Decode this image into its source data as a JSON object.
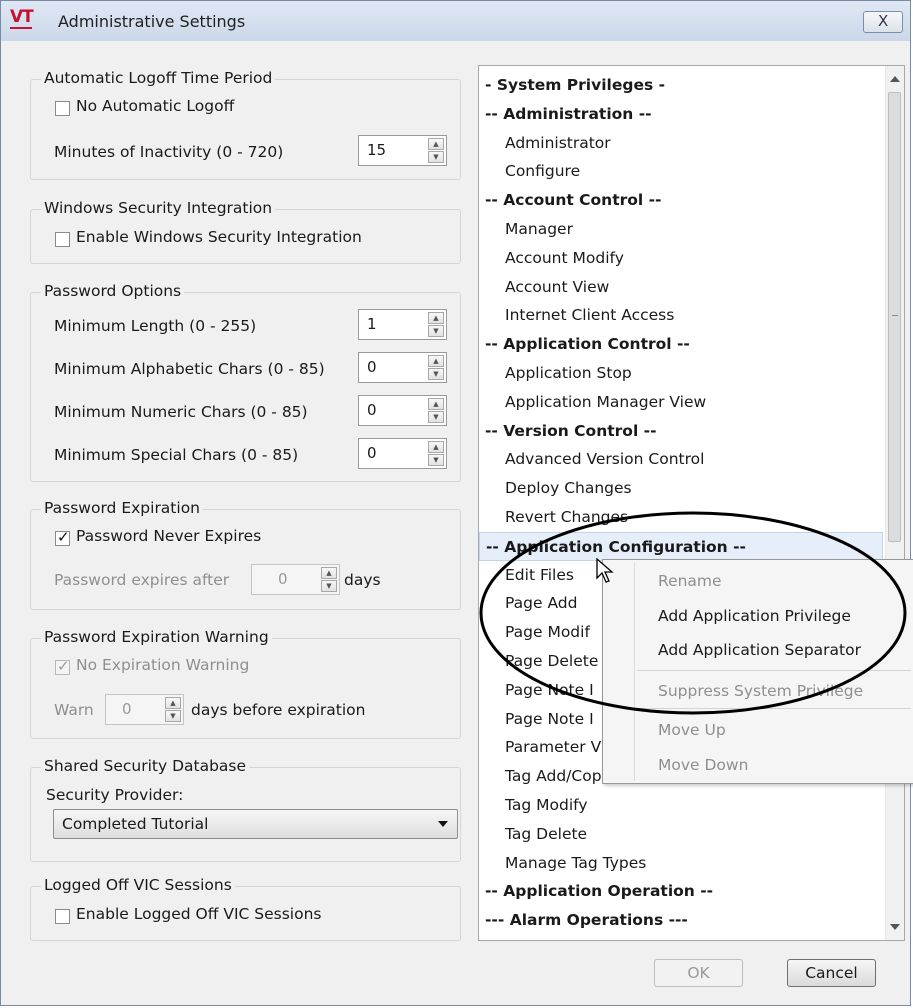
{
  "window": {
    "title": "Administrative Settings",
    "close_label": "X",
    "logo_text": "VT"
  },
  "logoff": {
    "legend": "Automatic Logoff Time Period",
    "no_logoff_label": "No Automatic Logoff",
    "no_logoff_checked": false,
    "minutes_label": "Minutes of Inactivity (0 - 720)",
    "minutes_value": "15"
  },
  "winsec": {
    "legend": "Windows Security Integration",
    "enable_label": "Enable Windows Security Integration",
    "enable_checked": false
  },
  "password": {
    "legend": "Password Options",
    "min_length_label": "Minimum Length (0 - 255)",
    "min_length_value": "1",
    "min_alpha_label": "Minimum Alphabetic Chars (0 - 85)",
    "min_alpha_value": "0",
    "min_numeric_label": "Minimum Numeric Chars (0 - 85)",
    "min_numeric_value": "0",
    "min_special_label": "Minimum Special Chars (0 - 85)",
    "min_special_value": "0"
  },
  "expiration": {
    "legend": "Password Expiration",
    "never_expires_label": "Password Never Expires",
    "never_expires_checked": true,
    "expires_after_label": "Password expires after",
    "expires_after_value": "0",
    "days_label": "days"
  },
  "warning": {
    "legend": "Password Expiration Warning",
    "no_warning_label": "No Expiration Warning",
    "no_warning_checked": true,
    "warn_label": "Warn",
    "warn_value": "0",
    "days_before_label": "days before expiration"
  },
  "shared_db": {
    "legend": "Shared Security Database",
    "provider_label": "Security Provider:",
    "provider_value": "Completed Tutorial"
  },
  "vic": {
    "legend": "Logged Off VIC Sessions",
    "enable_label": "Enable Logged Off VIC Sessions",
    "enable_checked": false
  },
  "privileges": {
    "items": [
      {
        "label": "- System Privileges -",
        "bold": true,
        "indent": 0
      },
      {
        "label": "-- Administration --",
        "bold": true,
        "indent": 0
      },
      {
        "label": "Administrator",
        "bold": false,
        "indent": 1
      },
      {
        "label": "Configure",
        "bold": false,
        "indent": 1
      },
      {
        "label": "-- Account Control --",
        "bold": true,
        "indent": 0
      },
      {
        "label": "Manager",
        "bold": false,
        "indent": 1
      },
      {
        "label": "Account Modify",
        "bold": false,
        "indent": 1
      },
      {
        "label": "Account View",
        "bold": false,
        "indent": 1
      },
      {
        "label": "Internet Client Access",
        "bold": false,
        "indent": 1
      },
      {
        "label": "-- Application Control --",
        "bold": true,
        "indent": 0
      },
      {
        "label": "Application Stop",
        "bold": false,
        "indent": 1
      },
      {
        "label": "Application Manager View",
        "bold": false,
        "indent": 1
      },
      {
        "label": "-- Version Control --",
        "bold": true,
        "indent": 0
      },
      {
        "label": "Advanced Version Control",
        "bold": false,
        "indent": 1
      },
      {
        "label": "Deploy Changes",
        "bold": false,
        "indent": 1
      },
      {
        "label": "Revert Changes",
        "bold": false,
        "indent": 1
      },
      {
        "label": "-- Application Configuration --",
        "bold": true,
        "indent": 0,
        "selected": true
      },
      {
        "label": "Edit Files",
        "bold": false,
        "indent": 1
      },
      {
        "label": "Page Add",
        "bold": false,
        "indent": 1
      },
      {
        "label": "Page Modif",
        "bold": false,
        "indent": 1
      },
      {
        "label": "Page Delete",
        "bold": false,
        "indent": 1
      },
      {
        "label": "Page Note I",
        "bold": false,
        "indent": 1
      },
      {
        "label": "Page Note I",
        "bold": false,
        "indent": 1
      },
      {
        "label": "Parameter V",
        "bold": false,
        "indent": 1
      },
      {
        "label": "Tag Add/Copy",
        "bold": false,
        "indent": 1
      },
      {
        "label": "Tag Modify",
        "bold": false,
        "indent": 1
      },
      {
        "label": "Tag Delete",
        "bold": false,
        "indent": 1
      },
      {
        "label": "Manage Tag Types",
        "bold": false,
        "indent": 1
      },
      {
        "label": "-- Application Operation --",
        "bold": true,
        "indent": 0
      },
      {
        "label": "--- Alarm Operations ---",
        "bold": true,
        "indent": 0
      }
    ]
  },
  "context_menu": {
    "items": [
      {
        "label": "Rename",
        "enabled": false
      },
      {
        "label": "Add Application Privilege",
        "enabled": true
      },
      {
        "label": "Add Application Separator",
        "enabled": true
      },
      {
        "label": "Suppress System Privilege",
        "enabled": false
      },
      {
        "label": "Move Up",
        "enabled": false
      },
      {
        "label": "Move Down",
        "enabled": false
      }
    ]
  },
  "buttons": {
    "ok": "OK",
    "cancel": "Cancel"
  }
}
